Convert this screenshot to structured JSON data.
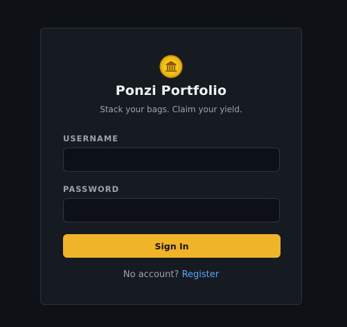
{
  "brand": {
    "icon": "coin-bank-icon",
    "title": "Ponzi Portfolio",
    "tagline": "Stack your bags. Claim your yield.",
    "accent_color": "#f0b429"
  },
  "form": {
    "username_label": "USERNAME",
    "username_value": "",
    "password_label": "PASSWORD",
    "password_value": "",
    "submit_label": "Sign In"
  },
  "footer": {
    "prompt": "No account?",
    "link_label": "Register",
    "link_color": "#58a6ff"
  }
}
